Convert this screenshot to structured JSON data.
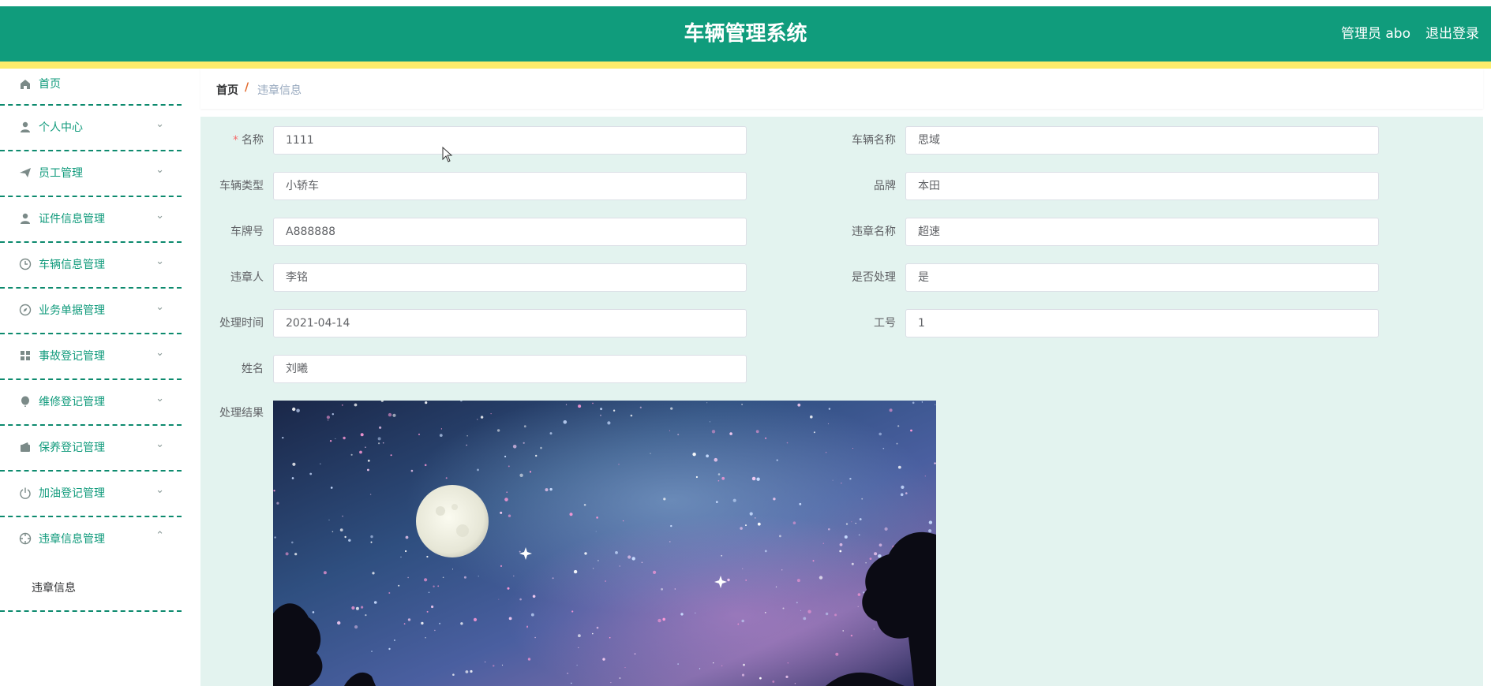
{
  "header": {
    "title": "车辆管理系统",
    "user": "管理员 abo",
    "logout": "退出登录"
  },
  "sidebar": {
    "items": [
      {
        "label": "首页",
        "icon": "home-icon"
      },
      {
        "label": "个人中心",
        "icon": "user-icon"
      },
      {
        "label": "员工管理",
        "icon": "paper-plane-icon"
      },
      {
        "label": "证件信息管理",
        "icon": "user-icon"
      },
      {
        "label": "车辆信息管理",
        "icon": "clock-icon"
      },
      {
        "label": "业务单据管理",
        "icon": "compass-icon"
      },
      {
        "label": "事故登记管理",
        "icon": "grid-icon"
      },
      {
        "label": "维修登记管理",
        "icon": "balloon-icon"
      },
      {
        "label": "保养登记管理",
        "icon": "wallet-icon"
      },
      {
        "label": "加油登记管理",
        "icon": "power-icon"
      },
      {
        "label": "违章信息管理",
        "icon": "target-icon"
      }
    ],
    "subitem": "违章信息"
  },
  "breadcrumb": {
    "home": "首页",
    "separator": "/",
    "current": "违章信息"
  },
  "form": {
    "name_label": "名称",
    "name_value": "1111",
    "vehicle_name_label": "车辆名称",
    "vehicle_name_value": "思域",
    "vehicle_type_label": "车辆类型",
    "vehicle_type_value": "小轿车",
    "brand_label": "品牌",
    "brand_value": "本田",
    "plate_label": "车牌号",
    "plate_value": "A888888",
    "violation_name_label": "违章名称",
    "violation_name_value": "超速",
    "violator_label": "违章人",
    "violator_value": "李铭",
    "handled_label": "是否处理",
    "handled_value": "是",
    "handle_time_label": "处理时间",
    "handle_time_value": "2021-04-14",
    "job_no_label": "工号",
    "job_no_value": "1",
    "full_name_label": "姓名",
    "full_name_value": "刘曦",
    "result_label": "处理结果"
  },
  "colors": {
    "header": "#109c7c",
    "accent_bar": "#fcec6b",
    "menu_text": "#0f9a7b",
    "content_bg": "#e3f3ef"
  }
}
